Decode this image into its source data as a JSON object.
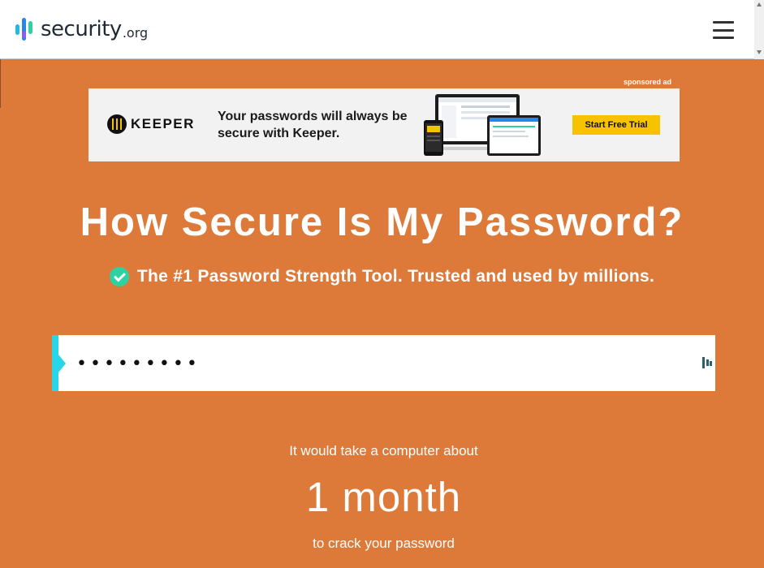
{
  "header": {
    "logo_text": "security",
    "logo_tld": ".org",
    "menu_icon": "hamburger-menu-icon"
  },
  "ad": {
    "sponsored_label": "sponsored ad",
    "brand": "KEEPER",
    "headline": "Your passwords will always be secure with Keeper.",
    "cta_label": "Start Free Trial",
    "brand_color": "#f7c300"
  },
  "hero": {
    "title": "How Secure Is My Password?",
    "subtitle": "The #1 Password Strength Tool. Trusted and used by millions.",
    "check_icon": "check-circle-icon"
  },
  "password": {
    "value": "•••••••••",
    "accent_color": "#29d6e8",
    "manager_icon": "password-manager-icon"
  },
  "result": {
    "prefix": "It would take a computer about",
    "time": "1 month",
    "suffix": "to crack your password"
  },
  "colors": {
    "background": "#dd7a3a",
    "check": "#2ed1a2"
  }
}
